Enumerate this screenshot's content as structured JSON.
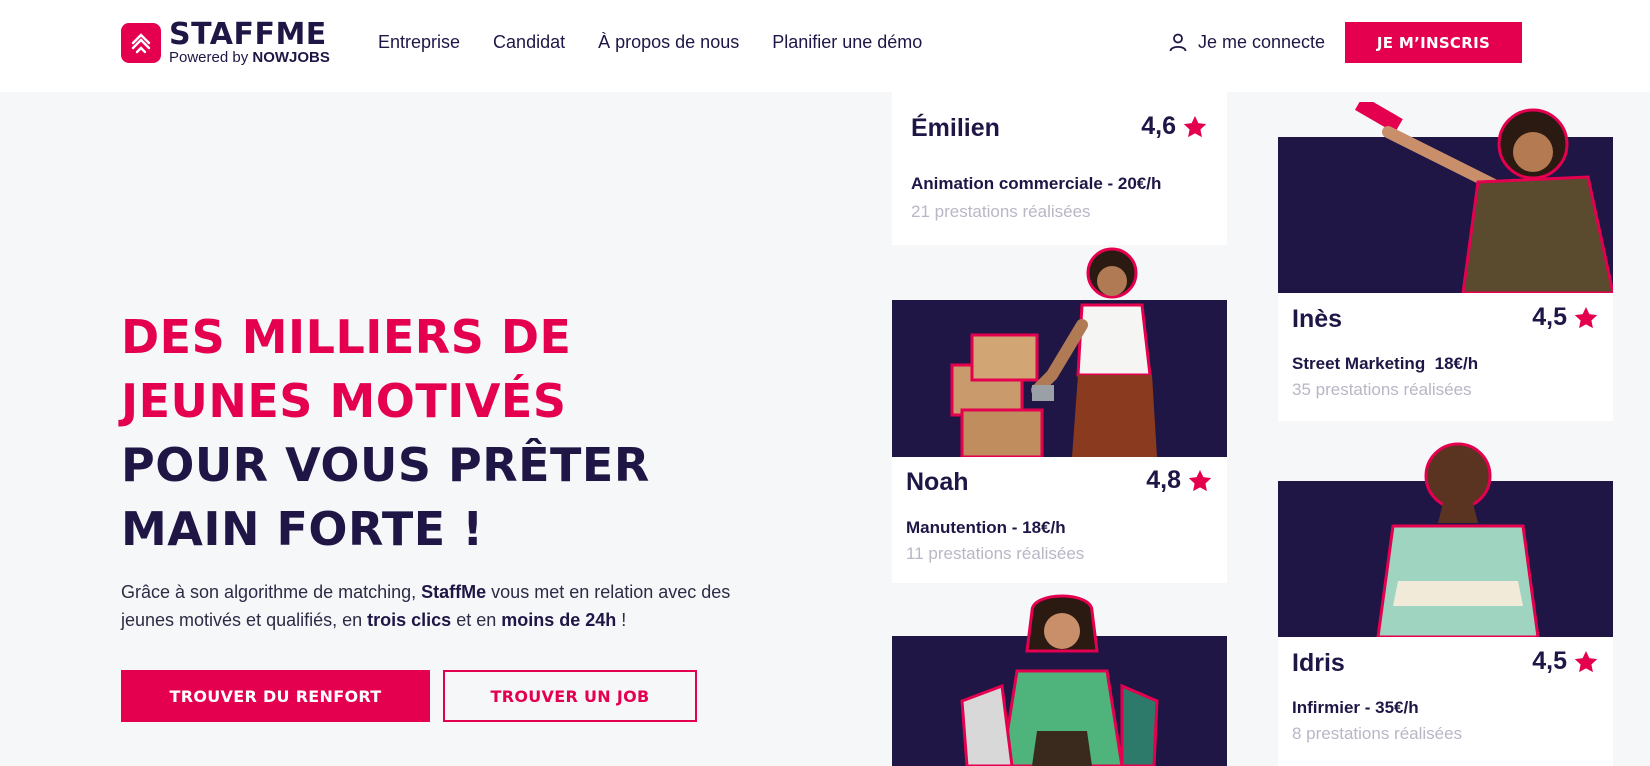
{
  "brand": {
    "name": "STAFFME",
    "powered_prefix": "Powered by",
    "powered_brand": "NOWJOBS",
    "accent": "#e4004f",
    "dark": "#1f1646"
  },
  "nav": {
    "items": [
      "Entreprise",
      "Candidat",
      "À propos de nous",
      "Planifier une démo"
    ],
    "login": "Je me connecte",
    "signup": "JE M’INSCRIS"
  },
  "hero": {
    "title_pink_1": "DES MILLIERS DE",
    "title_pink_2": "JEUNES MOTIVÉS",
    "title_dark_1": "POUR VOUS PRÊTER",
    "title_dark_2": "MAIN FORTE !",
    "desc_1": "Grâce à son algorithme de matching, ",
    "desc_brand": "StaffMe",
    "desc_2": " vous met en relation avec des jeunes motivés et qualifiés, en ",
    "desc_b1": "trois clics",
    "desc_3": " et en ",
    "desc_b2": "moins de 24h",
    "desc_4": " !",
    "cta_primary": "TROUVER DU RENFORT",
    "cta_secondary": "TROUVER UN JOB"
  },
  "cards": {
    "emilien": {
      "name": "Émilien",
      "rating": "4,6",
      "job": "Animation commerciale - 20€/h",
      "count": "21 prestations réalisées"
    },
    "noah": {
      "name": "Noah",
      "rating": "4,8",
      "job": "Manutention - 18€/h",
      "count": "11 prestations réalisées"
    },
    "ines": {
      "name": "Inès",
      "rating": "4,5",
      "job": "Street Marketing  18€/h",
      "count": "35 prestations réalisées"
    },
    "idris": {
      "name": "Idris",
      "rating": "4,5",
      "job": "Infirmier - 35€/h",
      "count": "8 prestations réalisées"
    }
  },
  "icons": {
    "logo": "staffme-logo-icon",
    "user": "user-icon",
    "star": "star-icon"
  }
}
